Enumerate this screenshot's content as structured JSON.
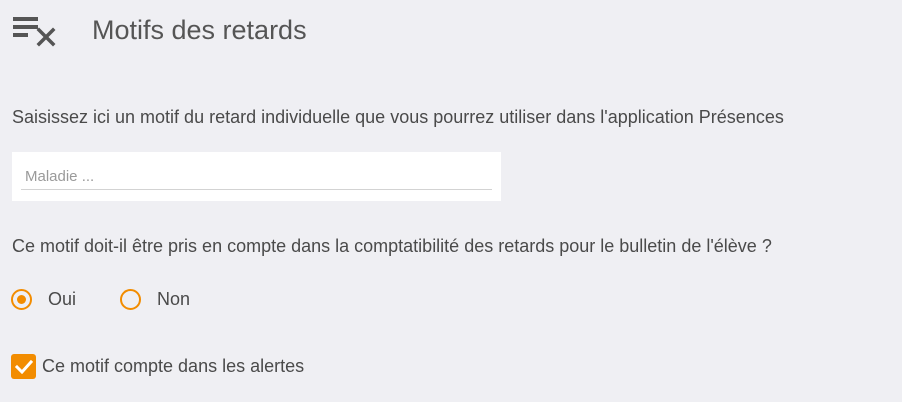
{
  "header": {
    "icon": "clear-list-icon",
    "title": "Motifs des retards"
  },
  "form": {
    "description": "Saisissez ici un motif du retard individuelle que vous pourrez utiliser dans l'application Présences",
    "motif_input": {
      "value": "",
      "placeholder": "Maladie ..."
    },
    "question": "Ce motif doit-il être pris en compte dans la comptatibilité des retards pour le bulletin de l'élève ?",
    "radio_options": [
      {
        "label": "Oui",
        "selected": true
      },
      {
        "label": "Non",
        "selected": false
      }
    ],
    "alert_checkbox": {
      "label": "Ce motif compte dans les alertes",
      "checked": true
    }
  },
  "colors": {
    "accent": "#f28c00",
    "background": "#efeff3",
    "text": "#4a4a4a",
    "input_background": "#ffffff"
  }
}
